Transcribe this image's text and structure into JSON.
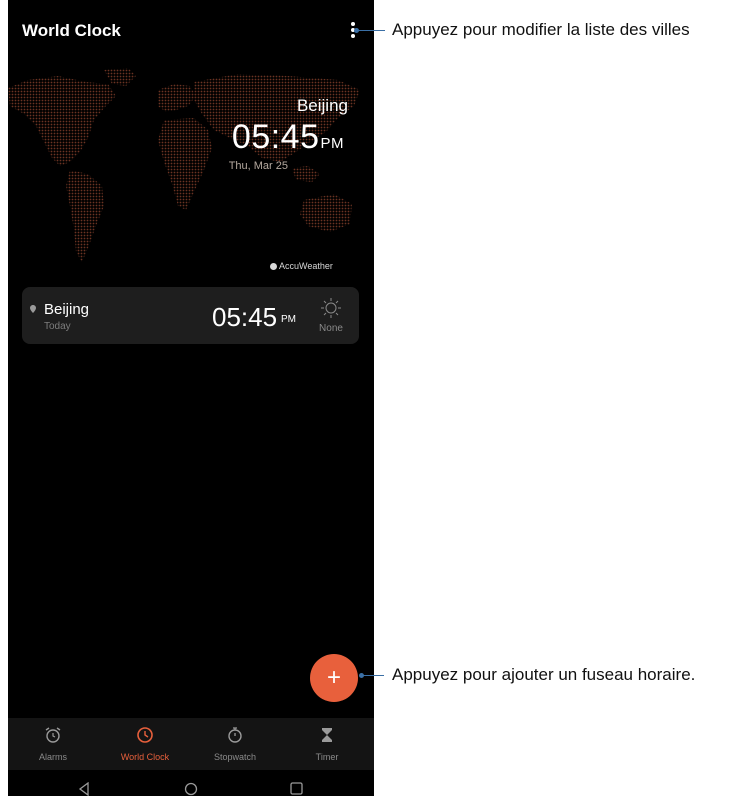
{
  "header": {
    "title": "World Clock"
  },
  "map": {
    "city": "Beijing",
    "time": "05:45",
    "ampm": "PM",
    "date": "Thu, Mar 25",
    "attribution": "AccuWeather"
  },
  "city_card": {
    "city": "Beijing",
    "day": "Today",
    "time": "05:45",
    "ampm": "PM",
    "weather": "None"
  },
  "fab": {
    "label": "+"
  },
  "nav": {
    "items": [
      {
        "label": "Alarms",
        "icon": "alarm-clock-icon"
      },
      {
        "label": "World Clock",
        "icon": "world-clock-icon",
        "active": true
      },
      {
        "label": "Stopwatch",
        "icon": "stopwatch-icon"
      },
      {
        "label": "Timer",
        "icon": "hourglass-icon"
      }
    ]
  },
  "annotations": {
    "menu": "Appuyez pour modifier la liste des villes",
    "add": "Appuyez pour ajouter un fuseau horaire."
  },
  "colors": {
    "background": "#000000",
    "accent": "#e8603c",
    "card": "#1e1e1e",
    "map_dots": "#5a2a1c",
    "leader": "#3a6fa5"
  }
}
